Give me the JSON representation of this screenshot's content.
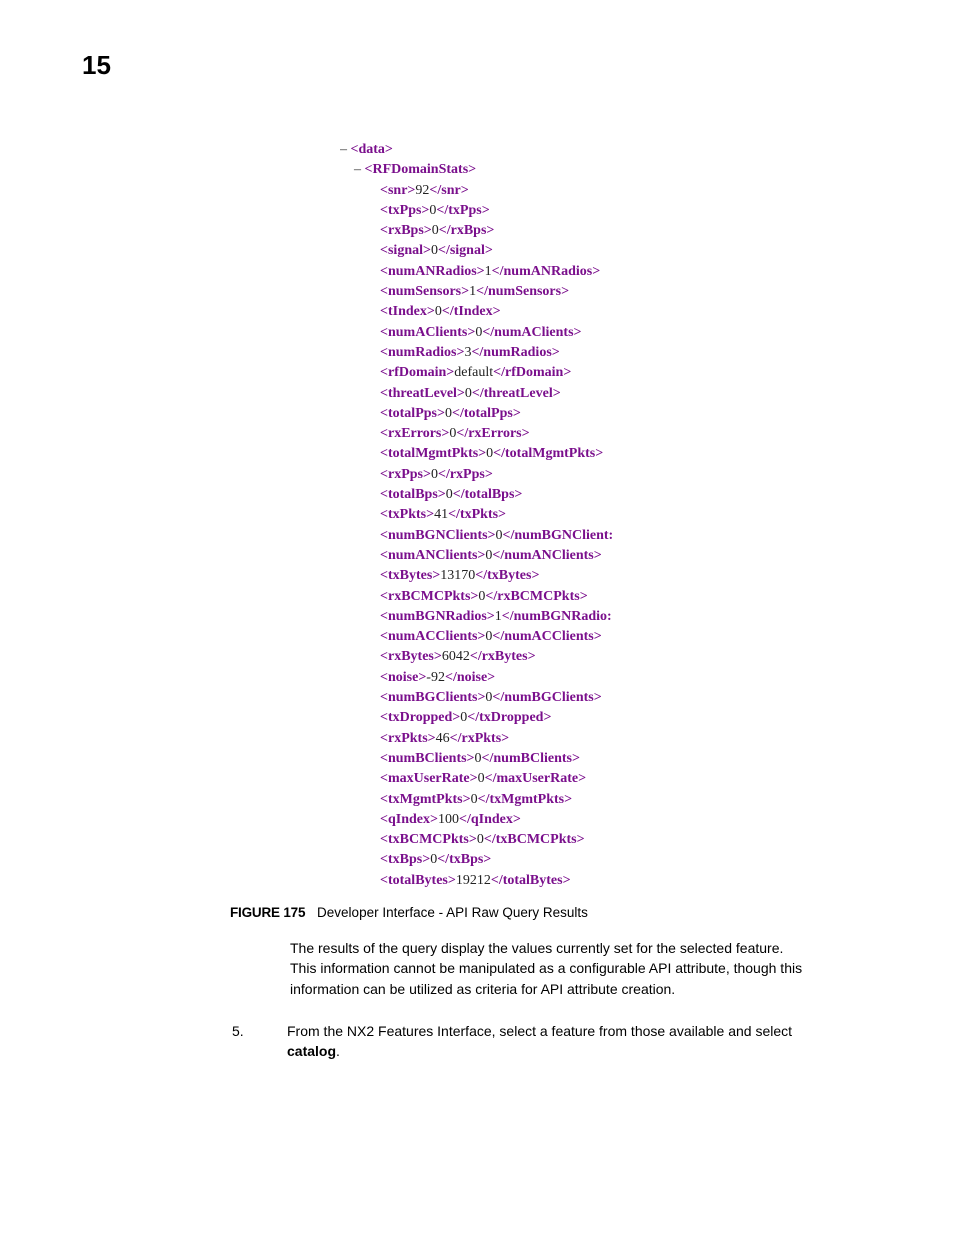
{
  "chapter": "15",
  "xml": {
    "root": "data",
    "group": "RFDomainStats",
    "elements": [
      {
        "tag": "snr",
        "value": "92"
      },
      {
        "tag": "txPps",
        "value": "0"
      },
      {
        "tag": "rxBps",
        "value": "0"
      },
      {
        "tag": "signal",
        "value": "0"
      },
      {
        "tag": "numANRadios",
        "value": "1"
      },
      {
        "tag": "numSensors",
        "value": "1"
      },
      {
        "tag": "tIndex",
        "value": "0"
      },
      {
        "tag": "numAClients",
        "value": "0"
      },
      {
        "tag": "numRadios",
        "value": "3"
      },
      {
        "tag": "rfDomain",
        "value": "default"
      },
      {
        "tag": "threatLevel",
        "value": "0"
      },
      {
        "tag": "totalPps",
        "value": "0"
      },
      {
        "tag": "rxErrors",
        "value": "0"
      },
      {
        "tag": "totalMgmtPkts",
        "value": "0"
      },
      {
        "tag": "rxPps",
        "value": "0"
      },
      {
        "tag": "totalBps",
        "value": "0"
      },
      {
        "tag": "txPkts",
        "value": "41"
      },
      {
        "tag": "numBGNClients",
        "value": "0",
        "closeTrim": "numBGNClient:"
      },
      {
        "tag": "numANClients",
        "value": "0"
      },
      {
        "tag": "txBytes",
        "value": "13170"
      },
      {
        "tag": "rxBCMCPkts",
        "value": "0"
      },
      {
        "tag": "numBGNRadios",
        "value": "1",
        "closeTrim": "numBGNRadio:"
      },
      {
        "tag": "numACClients",
        "value": "0"
      },
      {
        "tag": "rxBytes",
        "value": "6042"
      },
      {
        "tag": "noise",
        "value": "-92"
      },
      {
        "tag": "numBGClients",
        "value": "0"
      },
      {
        "tag": "txDropped",
        "value": "0"
      },
      {
        "tag": "rxPkts",
        "value": "46"
      },
      {
        "tag": "numBClients",
        "value": "0"
      },
      {
        "tag": "maxUserRate",
        "value": "0"
      },
      {
        "tag": "txMgmtPkts",
        "value": "0"
      },
      {
        "tag": "qIndex",
        "value": "100"
      },
      {
        "tag": "txBCMCPkts",
        "value": "0"
      },
      {
        "tag": "txBps",
        "value": "0"
      },
      {
        "tag": "totalBytes",
        "value": "19212"
      }
    ]
  },
  "figure": {
    "label": "FIGURE 175",
    "title": "Developer Interface - API Raw Query Results"
  },
  "paragraph": "The results of the query display the values currently set for the selected feature. This information cannot be manipulated as a configurable API attribute, though this information can be utilized as criteria for API attribute creation.",
  "step": {
    "num": "5.",
    "text_before": "From the NX2 Features Interface, select a feature from those available and select ",
    "bold": "catalog",
    "text_after": "."
  }
}
